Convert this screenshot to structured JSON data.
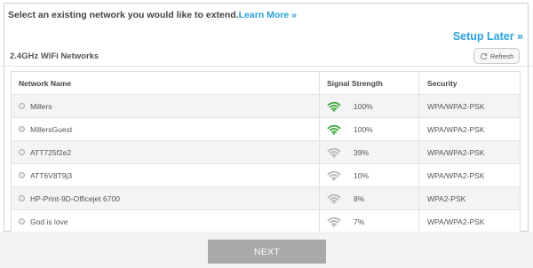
{
  "header": {
    "instruction": "Select an existing network you would like to extend.",
    "learn_more": "Learn More »",
    "setup_later": "Setup Later »"
  },
  "networks_section": {
    "title": "2.4GHz WiFi Networks",
    "refresh_label": "Refresh",
    "columns": [
      "Network Name",
      "Signal Strength",
      "Security"
    ],
    "rows": [
      {
        "name": "Millers",
        "signal": "100%",
        "signal_level": 1.0,
        "signal_color": "#3aa83a",
        "security": "WPA/WPA2-PSK"
      },
      {
        "name": "MillersGuest",
        "signal": "100%",
        "signal_level": 1.0,
        "signal_color": "#3aa83a",
        "security": "WPA/WPA2-PSK"
      },
      {
        "name": "ATT725f2e2",
        "signal": "39%",
        "signal_level": 0.39,
        "signal_color": "#b5b5b5",
        "security": "WPA/WPA2-PSK"
      },
      {
        "name": "ATT6V8T9j3",
        "signal": "10%",
        "signal_level": 0.1,
        "signal_color": "#b5b5b5",
        "security": "WPA/WPA2-PSK"
      },
      {
        "name": "HP-Print-9D-Officejet 6700",
        "signal": "8%",
        "signal_level": 0.08,
        "signal_color": "#b5b5b5",
        "security": "WPA2-PSK"
      },
      {
        "name": "God is love",
        "signal": "7%",
        "signal_level": 0.07,
        "signal_color": "#b5b5b5",
        "security": "WPA/WPA2-PSK"
      }
    ]
  },
  "footer": {
    "next_label": "NEXT"
  },
  "colors": {
    "accent": "#2aa0d8",
    "signal_strong": "#3aa83a",
    "signal_weak": "#b5b5b5",
    "next_button": "#a9a9a9"
  },
  "icons": {
    "refresh": "refresh-icon",
    "signal": "wifi-signal-icon",
    "radio": "radio-icon"
  }
}
